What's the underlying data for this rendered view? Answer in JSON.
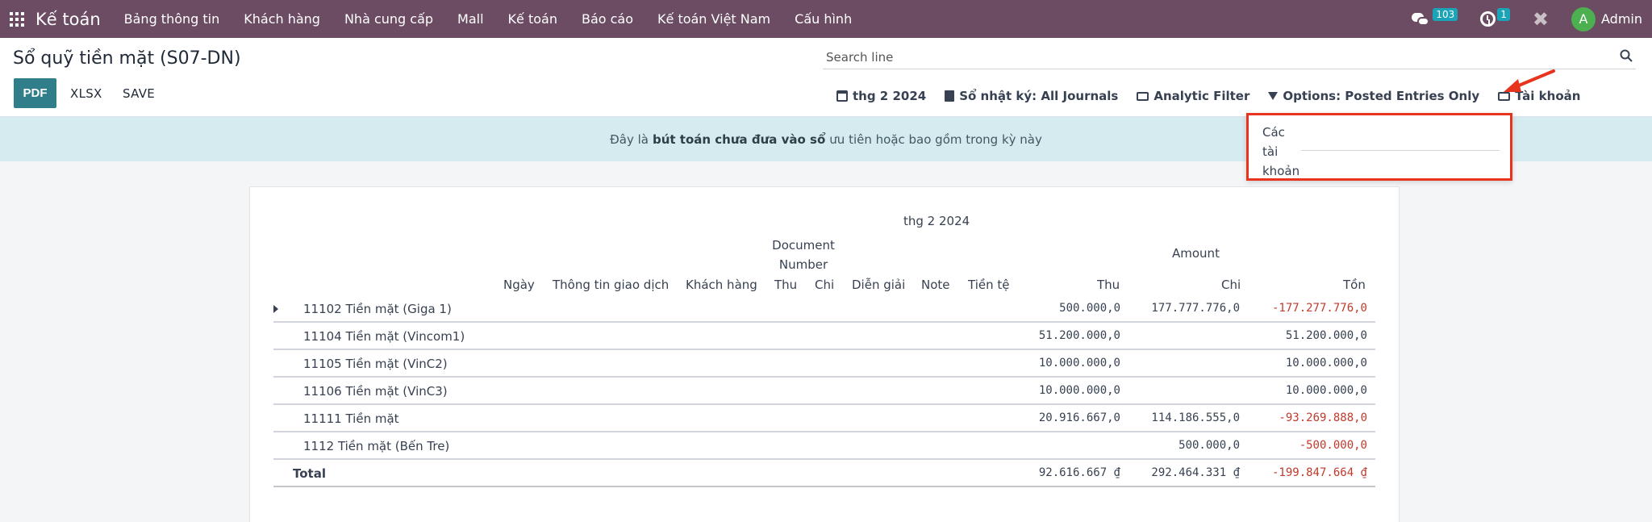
{
  "navbar": {
    "brand": "Kế toán",
    "menu": [
      "Bảng thông tin",
      "Khách hàng",
      "Nhà cung cấp",
      "Mall",
      "Kế toán",
      "Báo cáo",
      "Kế toán Việt Nam",
      "Cấu hình"
    ],
    "messages_count": "103",
    "activities_count": "1",
    "user_initial": "A",
    "user_name": "Admin"
  },
  "page": {
    "title": "Sổ quỹ tiền mặt (S07-DN)",
    "buttons": {
      "pdf": "PDF",
      "xlsx": "XLSX",
      "save": "SAVE"
    },
    "search_placeholder": "Search line",
    "filters": {
      "date": "thg 2 2024",
      "journals": "Sổ nhật ký: All Journals",
      "analytic": "Analytic Filter",
      "options": "Options: Posted Entries Only",
      "accounts": "Tài khoản"
    }
  },
  "banner": {
    "prefix": "Đây là",
    "bold": "bút toán chưa đưa vào sổ",
    "suffix": "ưu tiên hoặc bao gồm trong kỳ này"
  },
  "dropdown": {
    "label": "Các tài khoản",
    "value": ""
  },
  "report": {
    "period": "thg 2 2024",
    "doc_number_header": "Document Number",
    "amount_header": "Amount",
    "columns": [
      "Ngày",
      "Thông tin giao dịch",
      "Khách hàng",
      "Thu",
      "Chi",
      "Diễn giải",
      "Note",
      "Tiền tệ",
      "Thu",
      "Chi",
      "Tồn"
    ],
    "rows": [
      {
        "name": "11102 Tiền mặt (Giga 1)",
        "thu": "500.000,0",
        "chi": "177.777.776,0",
        "ton": "-177.277.776,0"
      },
      {
        "name": "11104 Tiền mặt (Vincom1)",
        "thu": "51.200.000,0",
        "chi": "",
        "ton": "51.200.000,0"
      },
      {
        "name": "11105 Tiền mặt (VinC2)",
        "thu": "10.000.000,0",
        "chi": "",
        "ton": "10.000.000,0"
      },
      {
        "name": "11106 Tiền mặt (VinC3)",
        "thu": "10.000.000,0",
        "chi": "",
        "ton": "10.000.000,0"
      },
      {
        "name": "11111 Tiền mặt",
        "thu": "20.916.667,0",
        "chi": "114.186.555,0",
        "ton": "-93.269.888,0"
      },
      {
        "name": "1112 Tiền mặt (Bến Tre)",
        "thu": "",
        "chi": "500.000,0",
        "ton": "-500.000,0"
      }
    ],
    "total": {
      "name": "Total",
      "thu": "92.616.667 ₫",
      "chi": "292.464.331 ₫",
      "ton": "-199.847.664 ₫"
    }
  },
  "colors": {
    "navbar": "#6b4c63",
    "primary": "#2f7e89",
    "banner": "#d6ebef",
    "negative": "#c0392b",
    "highlight": "#e8341c"
  }
}
